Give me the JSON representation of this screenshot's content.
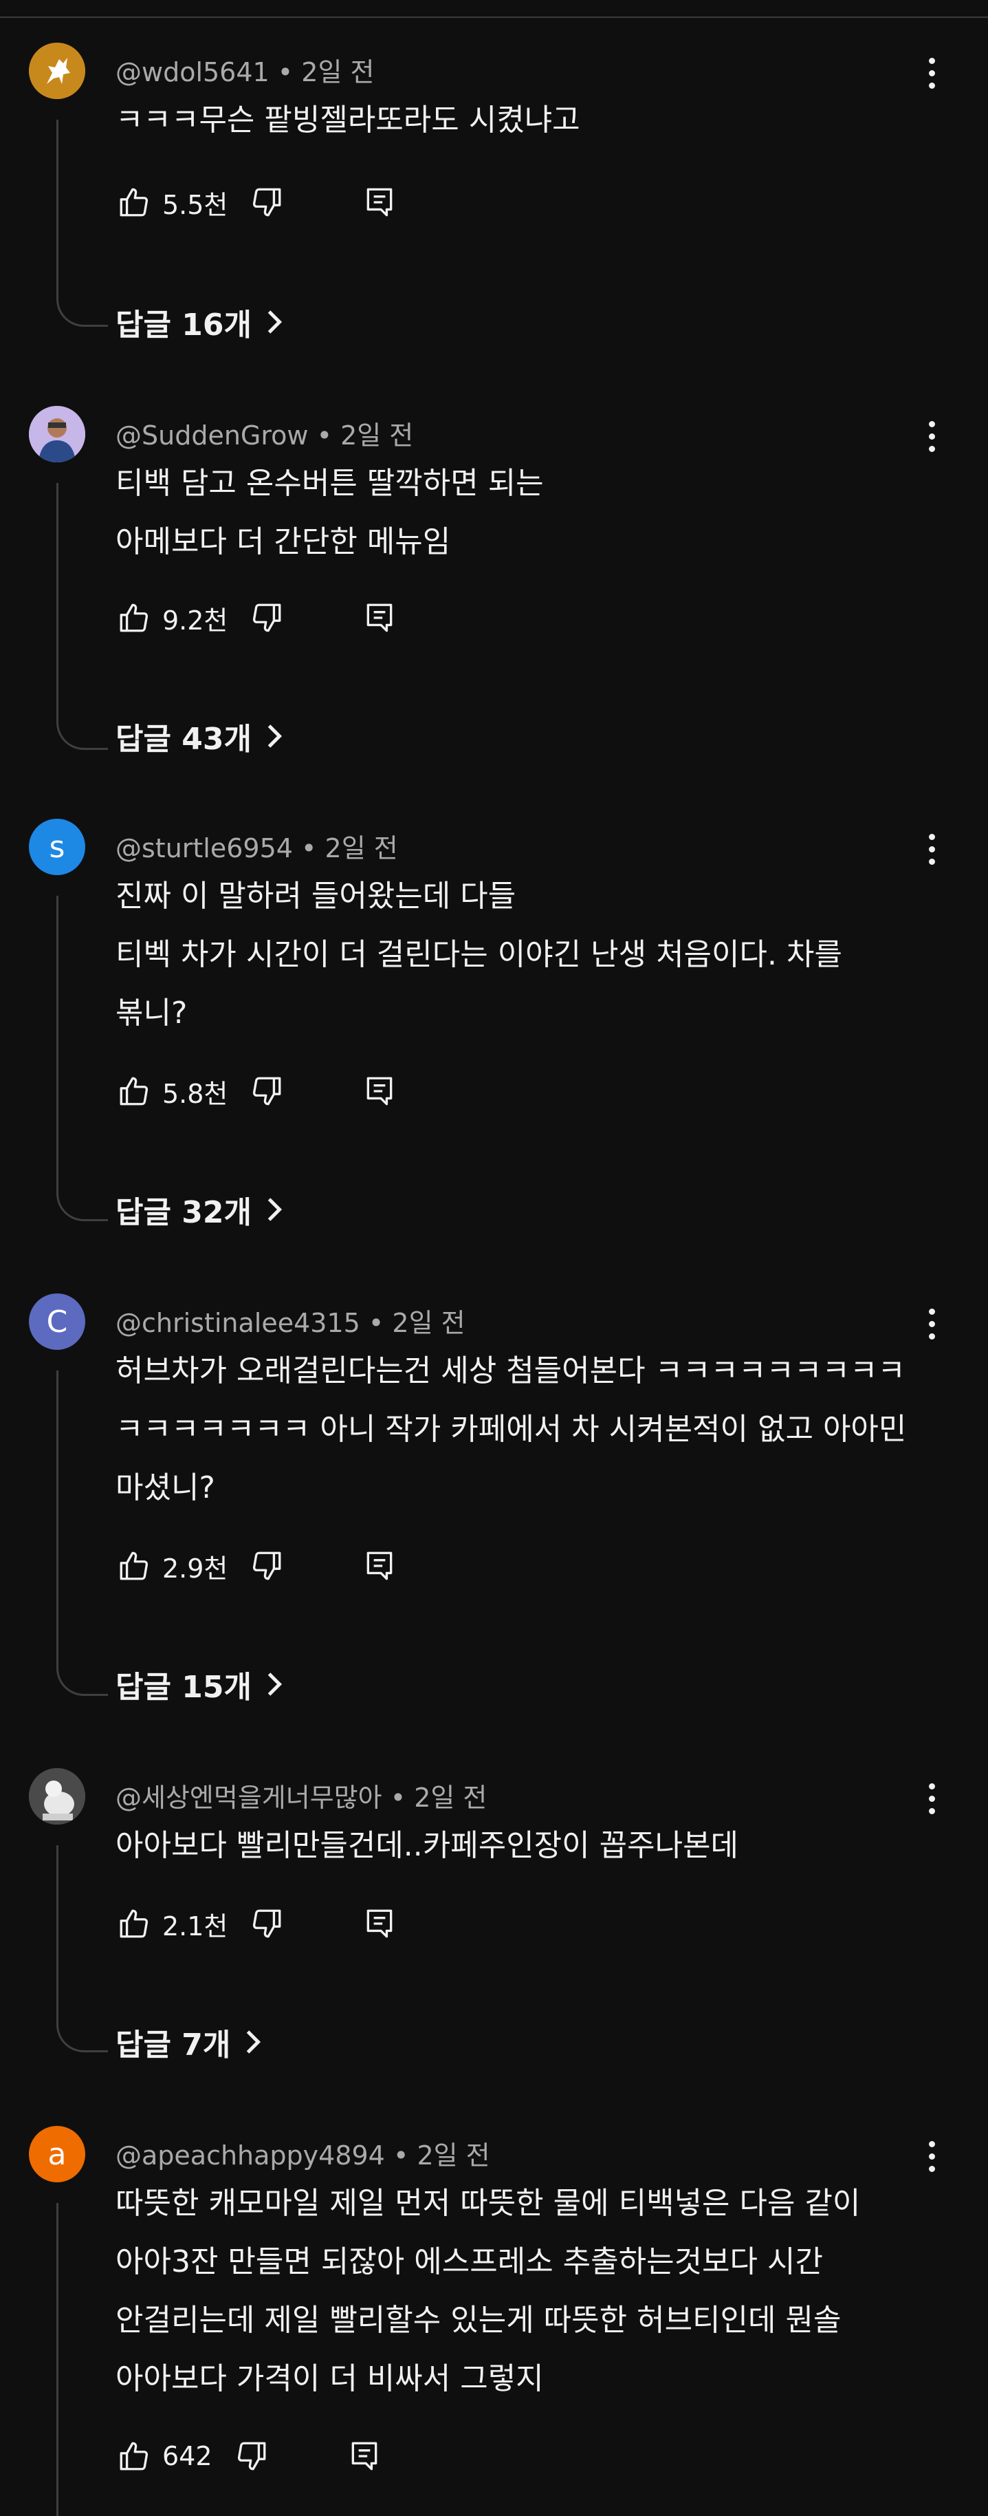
{
  "comments": [
    {
      "handle": "@wdol5641",
      "time": "2일 전",
      "avatar": {
        "type": "image",
        "bg": "#c8891c",
        "icon": "pegasus-icon"
      },
      "lines": [
        "ㅋㅋㅋ무슨 팥빙젤라또라도 시켰냐고"
      ],
      "likes": "5.5천",
      "replies": "답글 16개"
    },
    {
      "handle": "@SuddenGrow",
      "time": "2일 전",
      "avatar": {
        "type": "image",
        "bg": "#c7b6e8",
        "icon": "person-photo-icon"
      },
      "lines": [
        "티백 담고 온수버튼 딸깍하면 되는",
        "아메보다 더 간단한 메뉴임"
      ],
      "likes": "9.2천",
      "replies": "답글 43개"
    },
    {
      "handle": "@sturtle6954",
      "time": "2일 전",
      "avatar": {
        "type": "letter",
        "letter": "s",
        "bg": "#1e88e5"
      },
      "lines": [
        "진짜 이 말하려 들어왔는데 다들",
        "티벡 차가 시간이 더 걸린다는 이야긴 난생 처음이다.  차를",
        "볶니?"
      ],
      "likes": "5.8천",
      "replies": "답글 32개"
    },
    {
      "handle": "@christinalee4315",
      "time": "2일 전",
      "avatar": {
        "type": "letter",
        "letter": "C",
        "bg": "#5c6bc0"
      },
      "lines": [
        "허브차가 오래걸린다는건 세상 첨들어본다 ㅋㅋㅋㅋㅋㅋㅋㅋㅋ",
        "ㅋㅋㅋㅋㅋㅋㅋ 아니 작가 카페에서 차 시켜본적이 없고 아아민",
        "마셨니?"
      ],
      "likes": "2.9천",
      "replies": "답글 15개"
    },
    {
      "handle": "@세상엔먹을게너무많아",
      "time": "2일 전",
      "avatar": {
        "type": "image",
        "bg": "#6b6b6b",
        "icon": "statue-photo-icon"
      },
      "lines": [
        "아아보다 빨리만들건데..카페주인장이 꼽주나본데"
      ],
      "likes": "2.1천",
      "replies": "답글 7개"
    },
    {
      "handle": "@apeachhappy4894",
      "time": "2일 전",
      "avatar": {
        "type": "letter",
        "letter": "a",
        "bg": "#ef6c00"
      },
      "lines": [
        "따뜻한 캐모마일 제일 먼저 따뜻한 물에 티백넣은 다음 같이",
        "아아3잔 만들면 되잖아 에스프레소 추출하는것보다 시간",
        "안걸리는데 제일 빨리할수 있는게 따뜻한 허브티인데 뭔솔",
        "아아보다 가격이 더 비싸서 그렇지"
      ],
      "likes": "642",
      "replies": ""
    }
  ]
}
